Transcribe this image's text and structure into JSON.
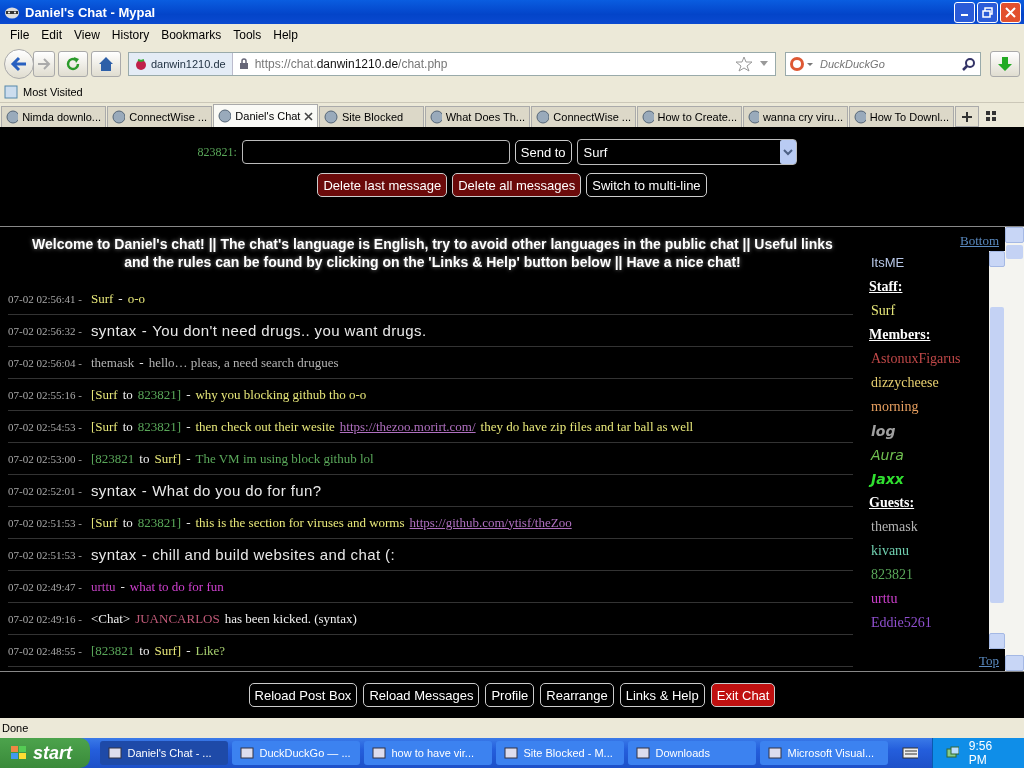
{
  "window": {
    "title": "Daniel's Chat - Mypal"
  },
  "menu": [
    "File",
    "Edit",
    "View",
    "History",
    "Bookmarks",
    "Tools",
    "Help"
  ],
  "nav": {
    "site_identity": "danwin1210.de",
    "url_prefix": "https://chat.",
    "url_domain": "danwin1210.de",
    "url_path": "/chat.php",
    "search_placeholder": "DuckDuckGo"
  },
  "bookmarks": [
    "Most Visited"
  ],
  "tabs": [
    {
      "label": "Nimda downlo...",
      "selected": false
    },
    {
      "label": "ConnectWise ...",
      "selected": false
    },
    {
      "label": "Daniel's Chat",
      "selected": true
    },
    {
      "label": "Site Blocked",
      "selected": false
    },
    {
      "label": "What Does Th...",
      "selected": false
    },
    {
      "label": "ConnectWise ...",
      "selected": false
    },
    {
      "label": "How to Create...",
      "selected": false
    },
    {
      "label": "wanna cry viru...",
      "selected": false
    },
    {
      "label": "How To Downl...",
      "selected": false
    }
  ],
  "post_form": {
    "nick": "823821:",
    "send_label": "Send to",
    "recipient": "Surf",
    "buttons": [
      {
        "label": "Delete last message",
        "kind": "danger"
      },
      {
        "label": "Delete all messages",
        "kind": "danger"
      },
      {
        "label": "Switch to multi-line",
        "kind": "normal"
      }
    ]
  },
  "welcome": "Welcome to Daniel's chat! || The chat's language is English, try to avoid other languages in the public chat || Useful links and the rules can be found by clicking on the 'Links & Help' button below || Have a nice chat!",
  "messages": [
    {
      "time": "07-02 02:56:41 -",
      "kind": "serif",
      "parts": [
        {
          "text": "Surf",
          "color": "#e8e87a"
        },
        {
          "text": "-"
        },
        {
          "text": "o-o",
          "color": "#e8e87a"
        }
      ]
    },
    {
      "time": "07-02 02:56:32 -",
      "kind": "sans",
      "parts": [
        {
          "text": "syntax"
        },
        {
          "text": "-"
        },
        {
          "text": "You don't need drugs.. you want drugs."
        }
      ]
    },
    {
      "time": "07-02 02:56:04 -",
      "kind": "serif",
      "parts": [
        {
          "text": "themask",
          "color": "#b4b4b4"
        },
        {
          "text": "-"
        },
        {
          "text": "hello… pleas, a need search drugues",
          "color": "#b4b4b4"
        }
      ]
    },
    {
      "time": "07-02 02:55:16 -",
      "kind": "serif",
      "parts": [
        {
          "text": "[Surf",
          "color": "#e8e87a"
        },
        {
          "text": "to"
        },
        {
          "text": "823821]",
          "color": "#5aa85a"
        },
        {
          "text": "-"
        },
        {
          "text": "why you blocking github tho o-o",
          "color": "#e8e87a"
        }
      ]
    },
    {
      "time": "07-02 02:54:53 -",
      "kind": "serif",
      "parts": [
        {
          "text": "[Surf",
          "color": "#e8e87a"
        },
        {
          "text": "to"
        },
        {
          "text": "823821]",
          "color": "#5aa85a"
        },
        {
          "text": "-"
        },
        {
          "text": "then check out their wesite",
          "color": "#e8e87a"
        },
        {
          "text": "https://thezoo.morirt.com/",
          "color": "#b070c0",
          "kind": "link"
        },
        {
          "text": "they do have zip files and tar ball as well",
          "color": "#e8e87a"
        }
      ]
    },
    {
      "time": "07-02 02:53:00 -",
      "kind": "serif",
      "parts": [
        {
          "text": "[823821",
          "color": "#5aa85a"
        },
        {
          "text": "to"
        },
        {
          "text": "Surf]",
          "color": "#e8e87a"
        },
        {
          "text": "-"
        },
        {
          "text": "The VM im using block github lol",
          "color": "#5aa85a"
        }
      ]
    },
    {
      "time": "07-02 02:52:01 -",
      "kind": "sans",
      "parts": [
        {
          "text": "syntax"
        },
        {
          "text": "-"
        },
        {
          "text": "What do you do for fun?"
        }
      ]
    },
    {
      "time": "07-02 02:51:53 -",
      "kind": "serif",
      "parts": [
        {
          "text": "[Surf",
          "color": "#e8e87a"
        },
        {
          "text": "to"
        },
        {
          "text": "823821]",
          "color": "#5aa85a"
        },
        {
          "text": "-"
        },
        {
          "text": "this is the section for viruses and worms",
          "color": "#e8e87a"
        },
        {
          "text": "https://github.com/ytisf/theZoo",
          "color": "#b070c0",
          "kind": "link"
        }
      ]
    },
    {
      "time": "07-02 02:51:53 -",
      "kind": "sans",
      "parts": [
        {
          "text": "syntax"
        },
        {
          "text": "-"
        },
        {
          "text": "chill and build websites and chat (:"
        }
      ]
    },
    {
      "time": "07-02 02:49:47 -",
      "kind": "serif",
      "parts": [
        {
          "text": "urttu",
          "color": "#c040c0"
        },
        {
          "text": "-"
        },
        {
          "text": "what to do for fun",
          "color": "#d040d0"
        }
      ]
    },
    {
      "time": "07-02 02:49:16 -",
      "kind": "serif",
      "parts": [
        {
          "text": "<Chat>"
        },
        {
          "text": "JUANCARLOS",
          "color": "#c05a78"
        },
        {
          "text": "has been kicked. (syntax)"
        }
      ]
    },
    {
      "time": "07-02 02:48:55 -",
      "kind": "serif",
      "parts": [
        {
          "text": "[823821",
          "color": "#5aa85a"
        },
        {
          "text": "to"
        },
        {
          "text": "Surf]",
          "color": "#e8e87a"
        },
        {
          "text": "-"
        },
        {
          "text": "Like?",
          "color": "#a8d070"
        }
      ]
    }
  ],
  "sidebar": {
    "top_link": "Bottom",
    "bottom_link": "Top",
    "groups": [
      {
        "users": [
          {
            "name": "ItsME",
            "color": "#b8c8e8",
            "kind": "sans"
          }
        ]
      },
      {
        "heading": "Staff:",
        "users": [
          {
            "name": "Surf",
            "color": "#e8e87a",
            "kind": "serif"
          }
        ]
      },
      {
        "heading": "Members:",
        "users": [
          {
            "name": "AstonuxFigarus",
            "color": "#c04848",
            "kind": "serif"
          },
          {
            "name": "dizzycheese",
            "color": "#e8d070",
            "kind": "serif"
          },
          {
            "name": "morning",
            "color": "#e8a060",
            "kind": "serif"
          },
          {
            "name": "log",
            "color": "#a0a0a0",
            "kind": "bold-italic-sans"
          },
          {
            "name": "Aura",
            "color": "#70c050",
            "kind": "italic-sans"
          },
          {
            "name": "Jaxx",
            "color": "#30e030",
            "kind": "bold-italic-sans"
          }
        ]
      },
      {
        "heading": "Guests:",
        "users": [
          {
            "name": "themask",
            "color": "#b4b4b4",
            "kind": "serif"
          },
          {
            "name": "kivanu",
            "color": "#70d0b0",
            "kind": "serif"
          },
          {
            "name": "823821",
            "color": "#5aa85a",
            "kind": "serif"
          },
          {
            "name": "urttu",
            "color": "#d040d0",
            "kind": "serif"
          },
          {
            "name": "Eddie5261",
            "color": "#9050d0",
            "kind": "serif"
          }
        ]
      }
    ]
  },
  "bottom_buttons": [
    {
      "label": "Reload Post Box",
      "kind": "normal"
    },
    {
      "label": "Reload Messages",
      "kind": "normal"
    },
    {
      "label": "Profile",
      "kind": "normal"
    },
    {
      "label": "Rearrange",
      "kind": "normal"
    },
    {
      "label": "Links & Help",
      "kind": "normal"
    },
    {
      "label": "Exit Chat",
      "kind": "exit"
    }
  ],
  "status_bar": "Done",
  "taskbar": {
    "start": "start",
    "items": [
      {
        "label": "Daniel's Chat - ...",
        "selected": true
      },
      {
        "label": "DuckDuckGo — ...",
        "selected": false
      },
      {
        "label": "how to have vir...",
        "selected": false
      },
      {
        "label": "Site Blocked - M...",
        "selected": false
      },
      {
        "label": "Downloads",
        "selected": false
      },
      {
        "label": "Microsoft Visual...",
        "selected": false
      }
    ],
    "clock": "9:56 PM"
  }
}
